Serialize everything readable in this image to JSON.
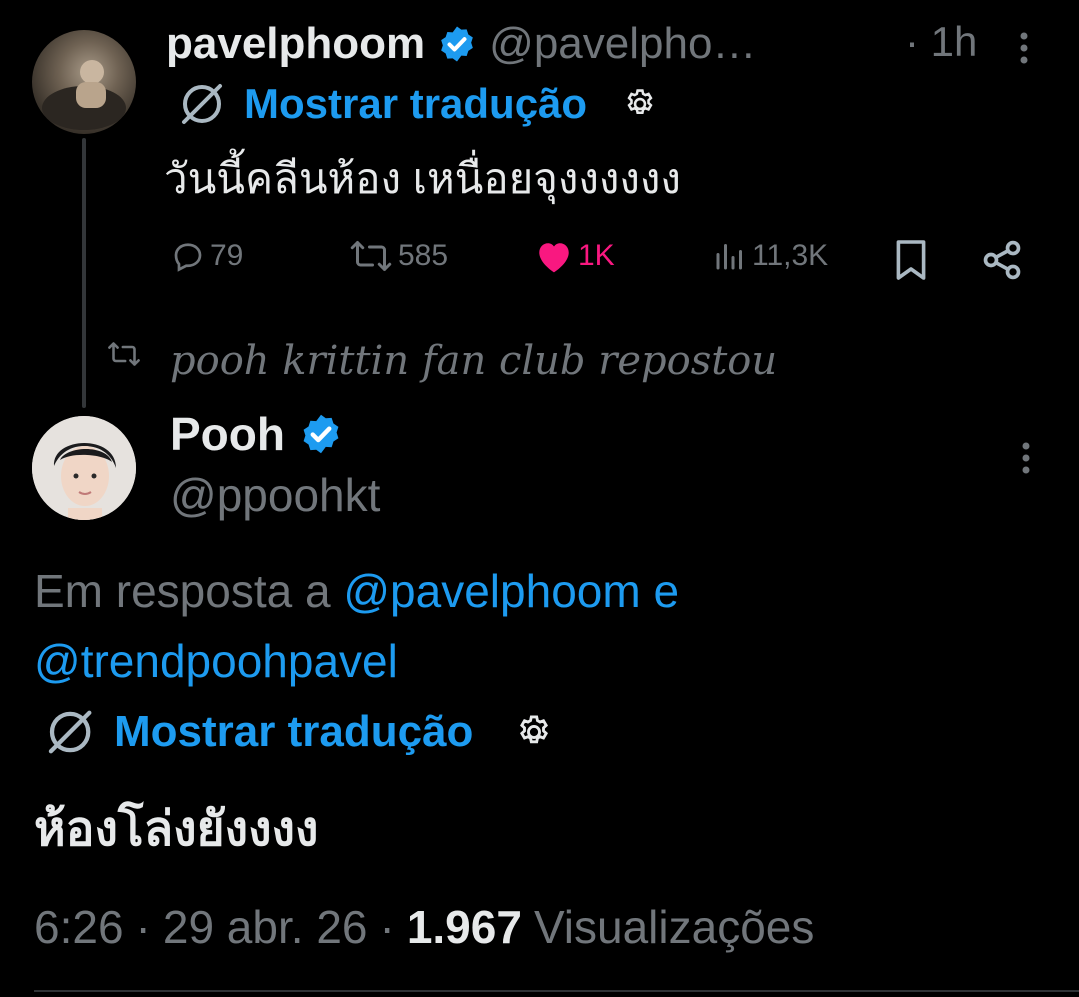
{
  "original_tweet": {
    "display_name": "pavelphoom",
    "handle": "@pavelpho…",
    "time": "· 1h",
    "translate_label": "Mostrar tradução",
    "text": "วันนี้คลีนห้อง เหนื่อยจุงงงงงง",
    "stats": {
      "replies": "79",
      "retweets": "585",
      "likes": "1K",
      "views": "11,3K"
    }
  },
  "repost_banner": {
    "text": "pooh krittin fan club repostou"
  },
  "main_tweet": {
    "display_name": "Pooh",
    "handle": "@ppoohkt",
    "reply_prefix": "Em resposta a",
    "reply_user1": "@pavelphoom",
    "reply_and": "e",
    "reply_user2": "@trendpoohpavel",
    "translate_label": "Mostrar tradução",
    "text": "ห้องโล่งยังงงง",
    "time": "6:26",
    "sep1": "·",
    "date": "29 abr. 26",
    "sep2": "·",
    "views_count": "1.967",
    "views_label": "Visualizações"
  },
  "colors": {
    "background": "#000000",
    "text": "#e7e9ea",
    "secondary": "#71767b",
    "accent": "#1d9bf0",
    "like": "#f91880"
  }
}
